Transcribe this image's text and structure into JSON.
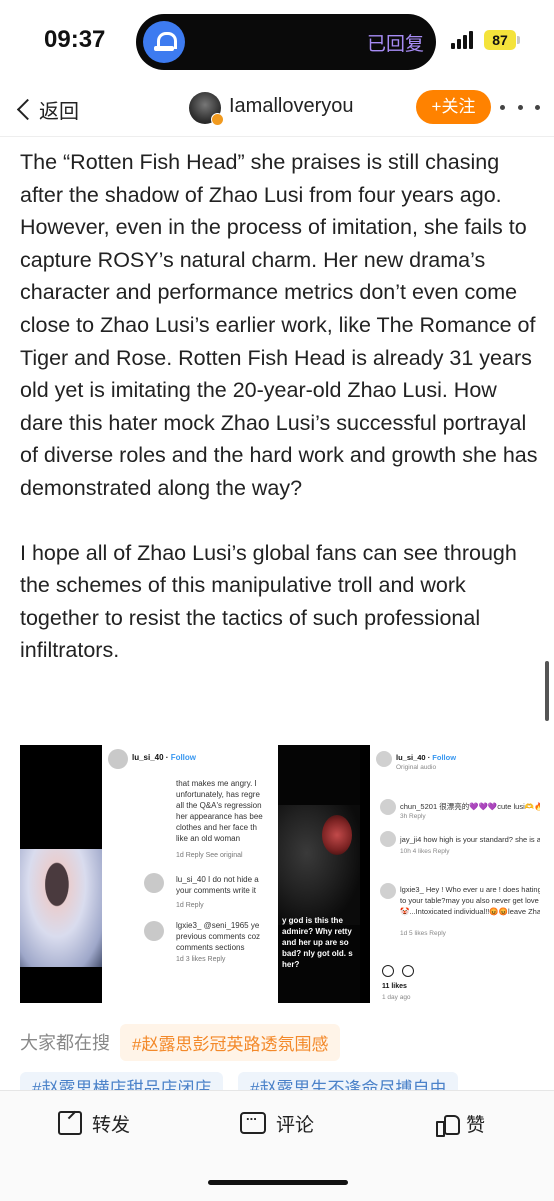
{
  "status_bar": {
    "time": "09:37",
    "island_text": "已回复",
    "island_icon": "bell-icon",
    "battery": "87",
    "colors": {
      "island_icon": "#3d7bf0",
      "island_text": "#a78cf5",
      "battery": "#f4e33b"
    }
  },
  "nav": {
    "back_label": "返回",
    "username": "Iamalloveryou",
    "follow_label": "+关注",
    "colors": {
      "follow": "#ff8200"
    }
  },
  "post": {
    "paragraphs": [
      "The “Rotten Fish Head” she praises is still chasing after the shadow of Zhao Lusi from four years ago. However, even in the process of imitation, she fails to capture ROSY’s natural charm. Her new drama’s character and performance metrics don’t even come close to Zhao Lusi’s earlier work, like The Romance of Tiger and Rose. Rotten Fish Head is already 31 years old yet is imitating the 20-year-old Zhao Lusi. How dare this hater mock Zhao Lusi’s successful portrayal of diverse roles and the hard work and growth she has demonstrated along the way?",
      "I hope all of Zhao Lusi’s global fans can see through the schemes of this manipulative troll and work together to resist the tactics of such professional infiltrators."
    ]
  },
  "image": {
    "card": {
      "username": "lu_si_40",
      "follow": "Follow",
      "comment1_lines": [
        "that makes me angry. I",
        "unfortunately, has regre",
        "all the Q&A's regression",
        "her appearance has bee",
        "clothes and her face th",
        "like an old woman"
      ],
      "comment1_meta": "1d    Reply    See original",
      "comment2_user_line": "lu_si_40 I do not hide a",
      "comment2_line2": "your comments write it",
      "comment2_meta": "1d    Reply",
      "comment3_user": "lgxie3_ @seni_1965 ye",
      "comment3_line2": "previous comments coz",
      "comment3_line3": "comments sections",
      "comment3_meta": "1d    3 likes    Reply"
    },
    "video_text": "y god is this the admire? Why retty and her up are so bad? nly got old. s her?",
    "panel": {
      "username": "lu_si_40",
      "follow": "Follow",
      "sub": "Original audio",
      "c1": "chun_5201 很漂亮的💜💜💜cute lusi🫶🔥🔥",
      "c1_meta": "3h    Reply",
      "c2": "jay_ji4 how high is your standard? she is a",
      "c2_meta": "10h    4 likes    Reply",
      "c3_l1": "lgxie3_ Hey ! Who ever u are ! does hating",
      "c3_l2": "to your table?may you also never get love",
      "c3_l3": "🤡...Intoxicated individual!!😡😡leave Zhao",
      "c3_meta": "1d    5 likes    Reply",
      "likes": "11 likes",
      "time": "1 day ago"
    }
  },
  "search": {
    "label": "大家都在搜",
    "tag1": "#赵露思彭冠英路透氛围感",
    "tag2": "#赵露思横店甜品店闭店",
    "tag3": "#赵露思生不逢命尽搏自由"
  },
  "bottom": {
    "share": "转发",
    "comment": "评论",
    "like": "赞"
  }
}
